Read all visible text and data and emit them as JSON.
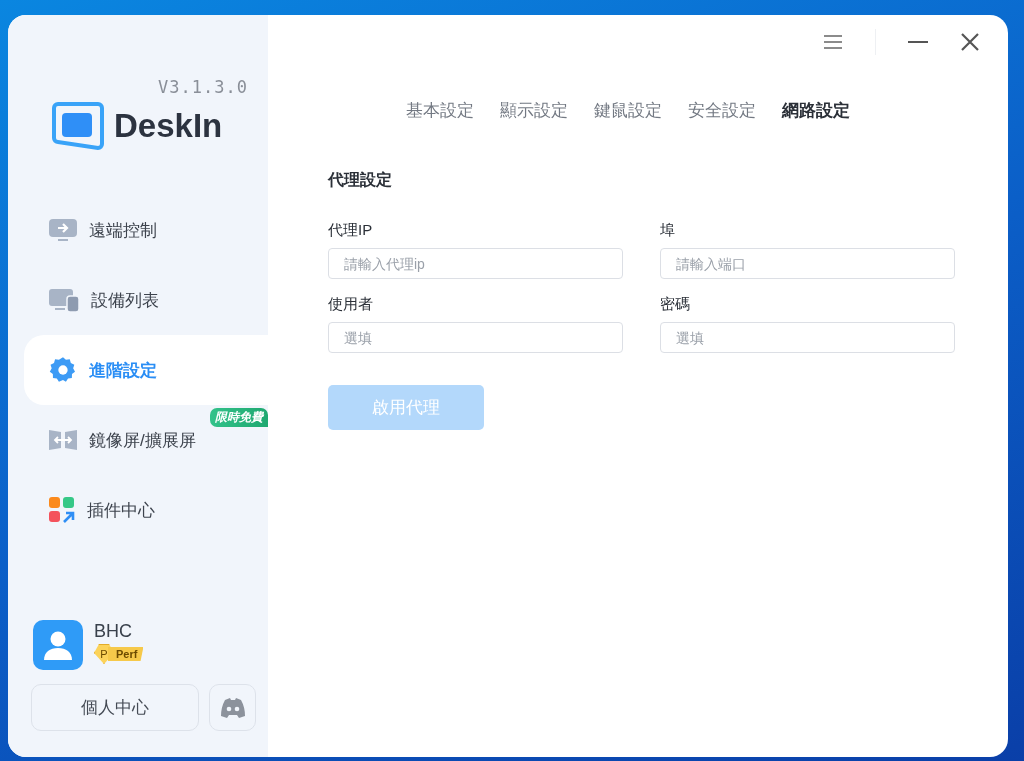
{
  "app": {
    "version": "V3.1.3.0",
    "name": "DeskIn"
  },
  "nav": [
    {
      "kind": "remote",
      "label": "遠端控制",
      "selected": false
    },
    {
      "kind": "devices",
      "label": "設備列表",
      "selected": false
    },
    {
      "kind": "settings",
      "label": "進階設定",
      "selected": true
    },
    {
      "kind": "display",
      "label": "鏡像屏/擴展屏",
      "selected": false,
      "badge": "限時免費"
    },
    {
      "kind": "plugins",
      "label": "插件中心",
      "selected": false
    }
  ],
  "user": {
    "name": "BHC",
    "tier_letter": "P",
    "tier": "Perf"
  },
  "profile_button": "個人中心",
  "tabs": [
    {
      "label": "基本設定",
      "selected": false
    },
    {
      "label": "顯示設定",
      "selected": false
    },
    {
      "label": "鍵鼠設定",
      "selected": false
    },
    {
      "label": "安全設定",
      "selected": false
    },
    {
      "label": "網路設定",
      "selected": true
    }
  ],
  "section_title": "代理設定",
  "fields": [
    {
      "label": "代理IP",
      "placeholder": "請輸入代理ip"
    },
    {
      "label": "埠",
      "placeholder": "請輸入端口"
    },
    {
      "label": "使用者",
      "placeholder": "選填"
    },
    {
      "label": "密碼",
      "placeholder": "選填"
    }
  ],
  "submit": {
    "label": "啟用代理",
    "disabled": true
  }
}
